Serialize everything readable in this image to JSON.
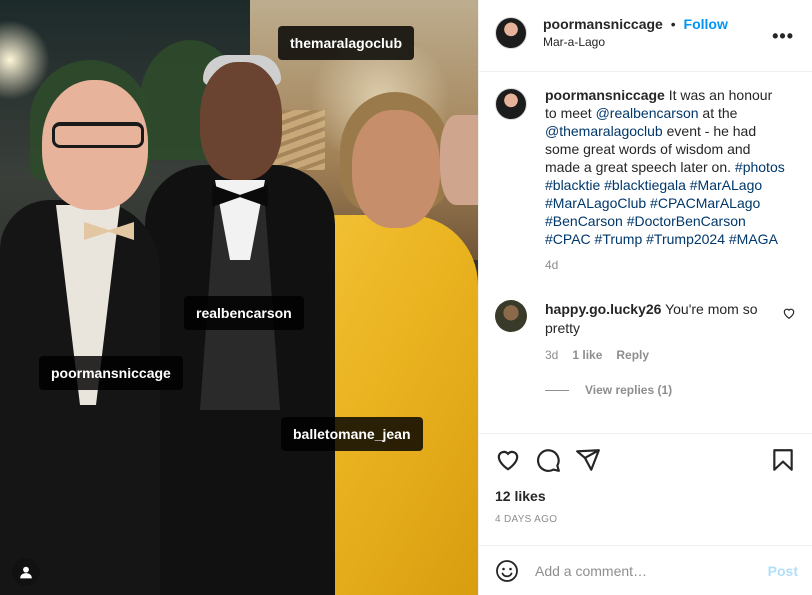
{
  "post": {
    "username": "poormansniccage",
    "follow_label": "Follow",
    "separator": "•",
    "location": "Mar-a-Lago",
    "more_label": "•••"
  },
  "photo": {
    "tags": [
      {
        "label": "themaralagoclub"
      },
      {
        "label": "realbencarson"
      },
      {
        "label": "poormansniccage"
      },
      {
        "label": "balletomane_jean"
      }
    ]
  },
  "caption": {
    "username": "poormansniccage",
    "parts": [
      " It was an honour to meet ",
      "@realbencarson",
      " at the ",
      "@themaralagoclub",
      " event - he had some great words of wisdom and made a great speech later on. ",
      "#photos #blacktie #blacktiegala #MarALago #MarALagoClub #CPACMarALago #BenCarson #DoctorBenCarson #CPAC #Trump #Trump2024 #MAGA"
    ],
    "time": "4d"
  },
  "comment": {
    "username": "happy.go.lucky26",
    "text": " You're mom so pretty",
    "time": "3d",
    "likes": "1 like",
    "reply_label": "Reply",
    "view_replies": "View replies (1)"
  },
  "actions": {
    "likes": "12 likes",
    "date": "4 DAYS AGO"
  },
  "add_comment": {
    "placeholder": "Add a comment…",
    "post_label": "Post"
  },
  "colors": {
    "link": "#00376b",
    "follow": "#0095f6",
    "muted": "#8e8e8e",
    "post_disabled": "#b2dffc"
  }
}
